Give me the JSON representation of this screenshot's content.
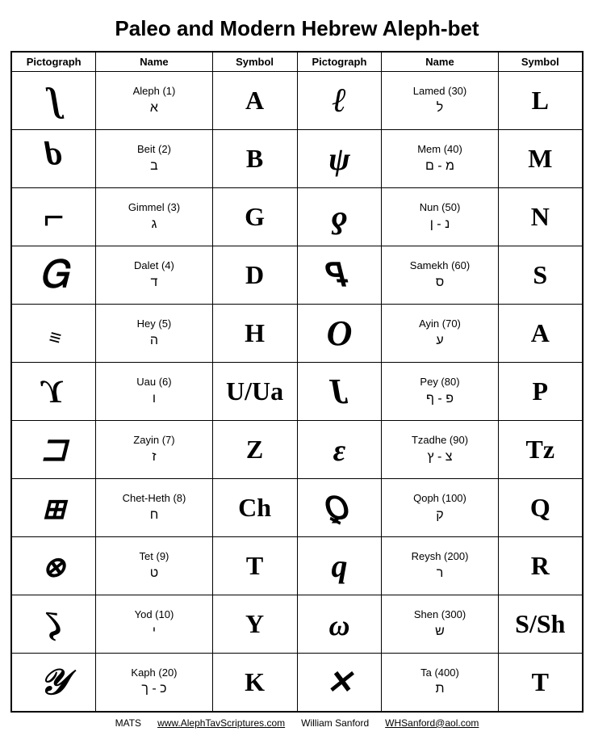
{
  "title": "Paleo and Modern Hebrew Aleph-bet",
  "headers": {
    "col1": "Pictograph",
    "col2": "Name",
    "col3": "Symbol",
    "col4": "Pictograph",
    "col5": "Name",
    "col6": "Symbol"
  },
  "rows": [
    {
      "left": {
        "pic": "𓃾",
        "pic_display": "ʄ",
        "name": "Aleph (1)",
        "hebrew": "א",
        "symbol": "A"
      },
      "right": {
        "pic": "𐤋",
        "pic_display": "ℓ",
        "name": "Lamed (30)",
        "hebrew": "ל",
        "symbol": "L"
      }
    },
    {
      "left": {
        "pic": "𐤁",
        "pic_display": "ᵽ",
        "name": "Beit (2)",
        "hebrew": "ב",
        "symbol": "B"
      },
      "right": {
        "pic": "𐤌",
        "pic_display": "ψ",
        "name": "Mem (40)",
        "hebrew": "מ - ם",
        "symbol": "M"
      }
    },
    {
      "left": {
        "pic": "𐤂",
        "pic_display": "⌐",
        "name": "Gimmel (3)",
        "hebrew": "ג",
        "symbol": "G"
      },
      "right": {
        "pic": "𐤍",
        "pic_display": "ƍ",
        "name": "Nun (50)",
        "hebrew": "נ - ן",
        "symbol": "N"
      }
    },
    {
      "left": {
        "pic": "𐤃",
        "pic_display": "Ꮐ",
        "name": "Dalet (4)",
        "hebrew": "ד",
        "symbol": "D"
      },
      "right": {
        "pic": "𐤎",
        "pic_display": "ᎇ",
        "name": "Samekh (60)",
        "hebrew": "ס",
        "symbol": "S"
      }
    },
    {
      "left": {
        "pic": "𐤄",
        "pic_display": "≡",
        "name": "Hey (5)",
        "hebrew": "ה",
        "symbol": "H"
      },
      "right": {
        "pic": "𐤏",
        "pic_display": "𝒪",
        "name": "Ayin (70)",
        "hebrew": "ע",
        "symbol": "A"
      }
    },
    {
      "left": {
        "pic": "𐤅",
        "pic_display": "ϒ",
        "name": "Uau (6)",
        "hebrew": "ו",
        "symbol": "U/Ua"
      },
      "right": {
        "pic": "𐤐",
        "pic_display": "ᒐ",
        "name": "Pey (80)",
        "hebrew": "פ - ף",
        "symbol": "P"
      }
    },
    {
      "left": {
        "pic": "𐤆",
        "pic_display": "⊐",
        "name": "Zayin (7)",
        "hebrew": "ז",
        "symbol": "Z"
      },
      "right": {
        "pic": "𐤑",
        "pic_display": "∃",
        "name": "Tzadhe (90)",
        "hebrew": "צ - ץ",
        "symbol": "Tz"
      }
    },
    {
      "left": {
        "pic": "𐤇",
        "pic_display": "⊞",
        "name": "Chet-Heth (8)",
        "hebrew": "ח",
        "symbol": "Ch"
      },
      "right": {
        "pic": "𐤒",
        "pic_display": "Ꝗ",
        "name": "Qoph (100)",
        "hebrew": "ק",
        "symbol": "Q"
      }
    },
    {
      "left": {
        "pic": "𐤈",
        "pic_display": "⊗",
        "name": "Tet (9)",
        "hebrew": "ט",
        "symbol": "T"
      },
      "right": {
        "pic": "𐤓",
        "pic_display": "ρ",
        "name": "Reysh (200)",
        "hebrew": "ר",
        "symbol": "R"
      }
    },
    {
      "left": {
        "pic": "𐤉",
        "pic_display": "ƶ",
        "name": "Yod (10)",
        "hebrew": "י",
        "symbol": "Y"
      },
      "right": {
        "pic": "𐤔",
        "pic_display": "ω",
        "name": "Shen (300)",
        "hebrew": "ש",
        "symbol": "S/Sh"
      }
    },
    {
      "left": {
        "pic": "𐤊",
        "pic_display": "𝒴",
        "name": "Kaph (20)",
        "hebrew": "כ - ך",
        "symbol": "K"
      },
      "right": {
        "pic": "𐤕",
        "pic_display": "✕",
        "name": "Ta (400)",
        "hebrew": "ת",
        "symbol": "T"
      }
    }
  ],
  "footer": {
    "org": "MATS",
    "website": "www.AlephTavScriptures.com",
    "author": "William Sanford",
    "email": "WHSanford@aol.com"
  },
  "pictographs": {
    "aleph": "ʄ",
    "beit": "ᵽ",
    "gimmel": "⌐",
    "dalet": "Ꮐ",
    "hey": "≡",
    "uau": "ϒ",
    "zayin": "⊐",
    "cheth": "⊞",
    "tet": "⊗",
    "yod": "ƶ",
    "kaph": "𝒴",
    "lamed": "ℓ",
    "mem": "ψ",
    "nun": "ƍ",
    "samekh": "⊏",
    "ayin": "𝒪",
    "pey": "ᒐ",
    "tzadhe": "∃",
    "qoph": "Ꝗ",
    "reysh": "ρ",
    "shen": "ω",
    "ta": "✕"
  }
}
